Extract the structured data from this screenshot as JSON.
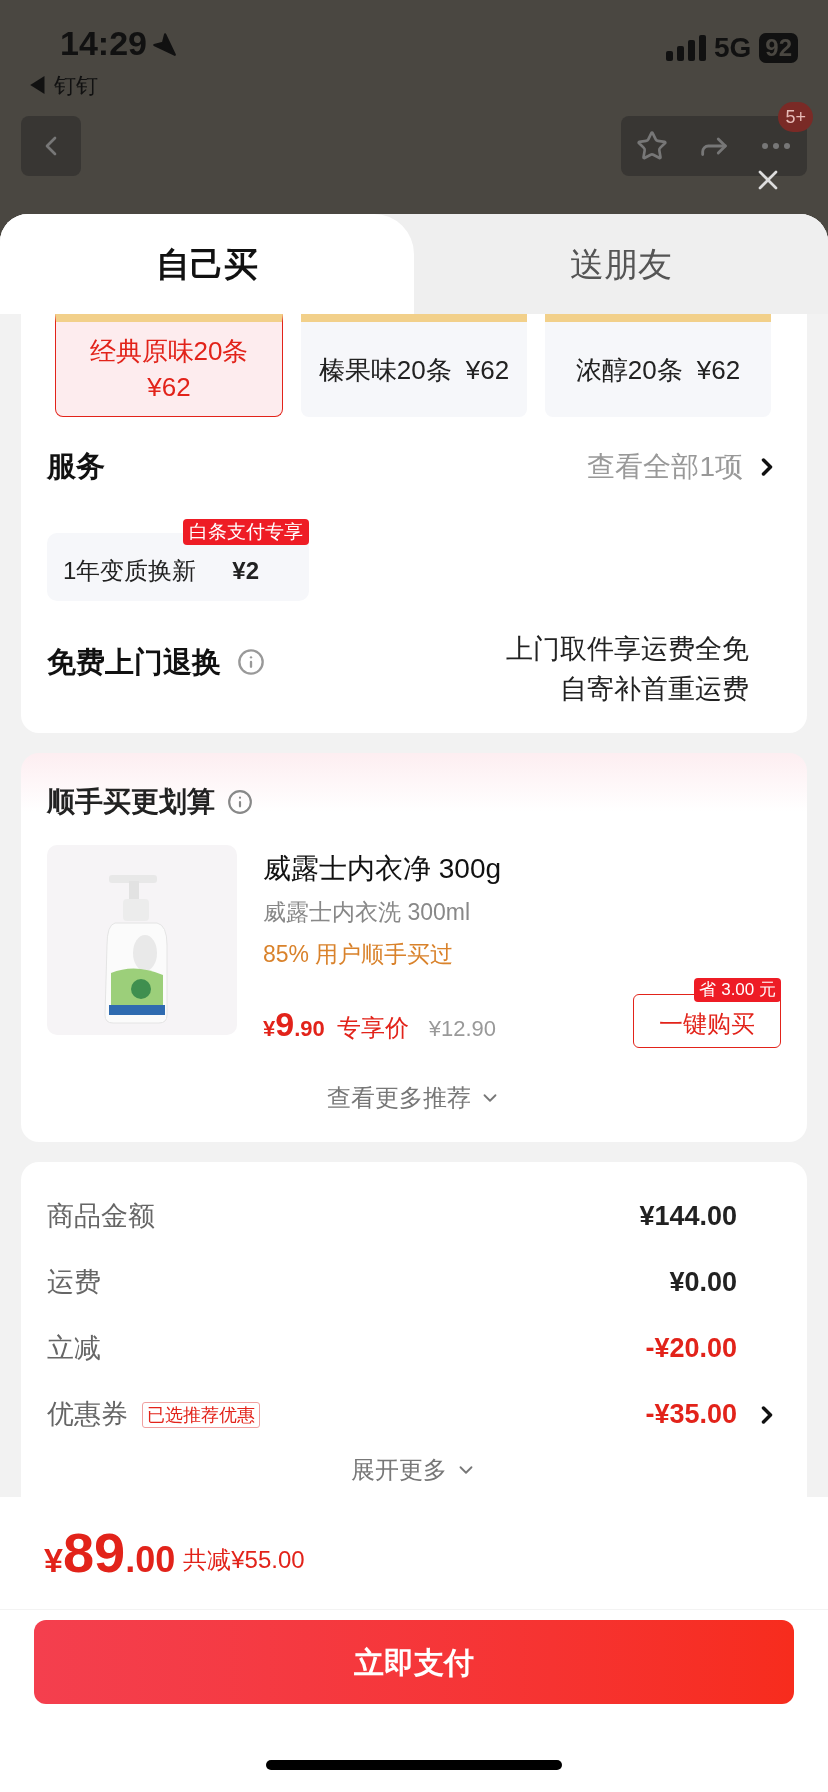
{
  "status_bar": {
    "time": "14:29",
    "back_app": "◀ 钉钉",
    "network": "5G",
    "battery": "92"
  },
  "nav": {
    "badge": "5+"
  },
  "tabs": [
    {
      "label": "自己买",
      "selected": true
    },
    {
      "label": "送朋友",
      "selected": false
    }
  ],
  "options": [
    {
      "label": "经典原味20条",
      "price": "¥62",
      "selected": true
    },
    {
      "label": "榛果味20条",
      "price": "¥62",
      "selected": false
    },
    {
      "label": "浓醇20条",
      "price": "¥62",
      "selected": false
    }
  ],
  "service": {
    "title": "服务",
    "link": "查看全部1项",
    "items": [
      {
        "name": "1年变质换新",
        "price": "¥2",
        "tag": "白条支付专享"
      }
    ]
  },
  "return": {
    "title": "免费上门退换",
    "lines": [
      "上门取件享运费全免",
      "自寄补首重运费"
    ]
  },
  "recommend": {
    "title": "顺手买更划算",
    "product": {
      "name": "威露士内衣净 300g",
      "subtitle": "威露士内衣洗 300ml",
      "note": "85% 用户顺手买过",
      "currency": "¥",
      "price_int": "9",
      "price_dec": ".90",
      "price_label": "专享价",
      "original_price": "¥12.90",
      "save_tag": "省 3.00 元",
      "buy": "一键购买"
    },
    "more": "查看更多推荐"
  },
  "summary": {
    "rows": [
      {
        "label": "商品金额",
        "value": "¥144.00",
        "kind": "normal"
      },
      {
        "label": "运费",
        "value": "¥0.00",
        "kind": "normal"
      },
      {
        "label": "立减",
        "value": "-¥20.00",
        "kind": "discount"
      },
      {
        "label": "优惠券",
        "tag": "已选推荐优惠",
        "value": "-¥35.00",
        "kind": "discount",
        "link": true
      }
    ],
    "more": "展开更多"
  },
  "footer": {
    "currency": "¥",
    "total_int": "89",
    "total_dec": ".00",
    "saved": "共减¥55.00",
    "pay": "立即支付"
  }
}
